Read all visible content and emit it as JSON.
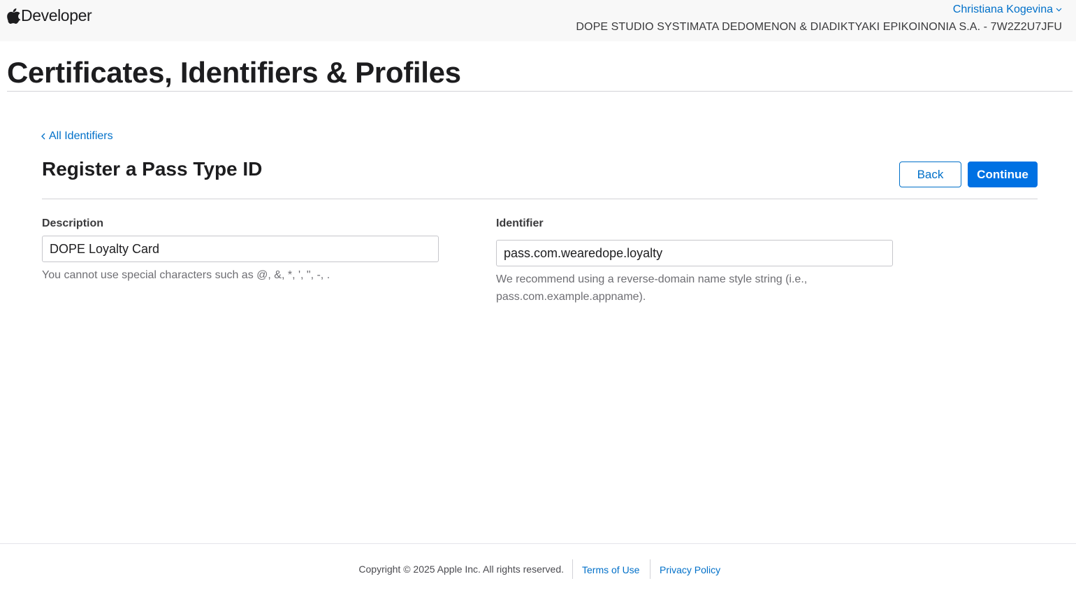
{
  "header": {
    "brand_label": "Developer",
    "account_name": "Christiana Kogevina",
    "team_name": "DOPE STUDIO SYSTIMATA DEDOMENON & DIADIKTYAKI EPIKOINONIA S.A. - 7W2Z2U7JFU"
  },
  "page": {
    "title": "Certificates, Identifiers & Profiles"
  },
  "content": {
    "back_link": "All Identifiers",
    "section_title": "Register a Pass Type ID",
    "back_button": "Back",
    "continue_button": "Continue",
    "description": {
      "label": "Description",
      "value": "DOPE Loyalty Card",
      "helper": "You cannot use special characters such as @, &, *, ', \", -, ."
    },
    "identifier": {
      "label": "Identifier",
      "value": "pass.com.wearedope.loyalty",
      "helper": "We recommend using a reverse-domain name style string (i.e., pass.com.example.appname)."
    }
  },
  "footer": {
    "copyright": "Copyright © 2025 Apple Inc. All rights reserved.",
    "terms": "Terms of Use",
    "privacy": "Privacy Policy"
  },
  "colors": {
    "link": "#0070c9",
    "primary_button": "#0071e3",
    "header_bg": "#f8f8f8"
  },
  "icons": {
    "brand": "apple-logo-icon",
    "account_menu": "chevron-down-icon",
    "back_link": "chevron-left-icon"
  }
}
